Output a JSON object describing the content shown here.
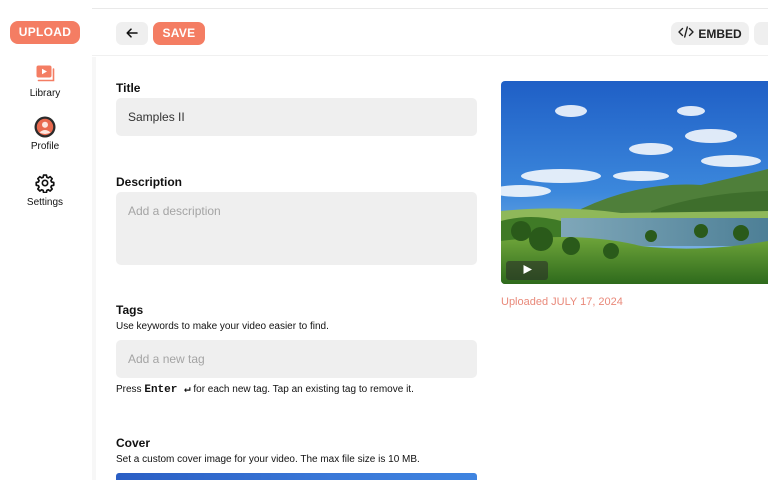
{
  "sidebar": {
    "upload_label": "UPLOAD",
    "items": [
      {
        "label": "Library",
        "icon": "library-icon"
      },
      {
        "label": "Profile",
        "icon": "avatar"
      },
      {
        "label": "Settings",
        "icon": "gear-icon"
      }
    ]
  },
  "header": {
    "back_icon": "arrow-left-icon",
    "save_label": "SAVE",
    "embed_icon": "code-icon",
    "embed_label": "EMBED"
  },
  "form": {
    "title_label": "Title",
    "title_value": "Samples II",
    "description_label": "Description",
    "description_placeholder": "Add a description",
    "tags_label": "Tags",
    "tags_helper": "Use keywords to make your video easier to find.",
    "tags_placeholder": "Add a new tag",
    "tags_hint_prefix": "Press",
    "tags_hint_key": "Enter ↵",
    "tags_hint_suffix": "for each new tag. Tap an existing tag to remove it.",
    "cover_label": "Cover",
    "cover_helper": "Set a custom cover image for your video. The max file size is 10 MB."
  },
  "video": {
    "uploaded_text": "Uploaded JULY 17, 2024",
    "play_icon": "play-icon"
  },
  "colors": {
    "accent": "#f47d63",
    "uploaded_text": "#e9897a",
    "input_bg": "#efefef"
  }
}
